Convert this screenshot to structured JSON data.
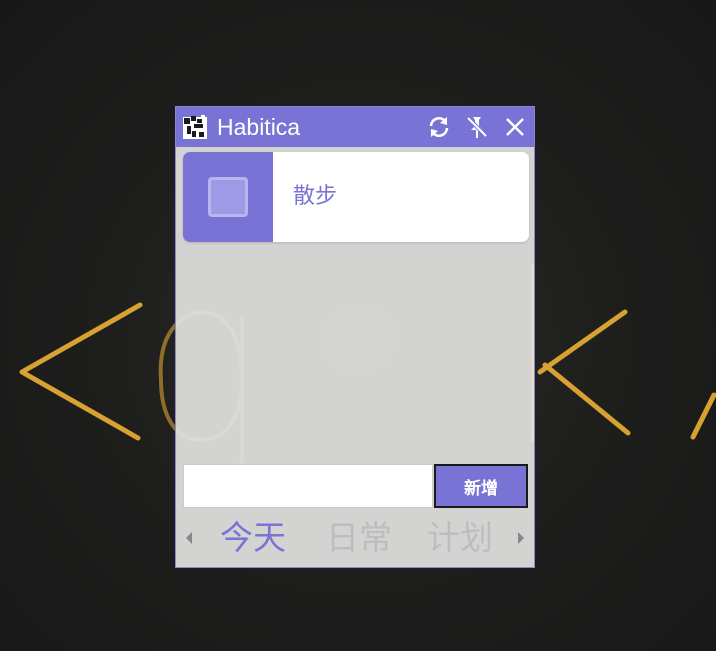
{
  "window": {
    "title": "Habitica",
    "accent_color": "#7a73d6",
    "titlebar_buttons": [
      {
        "name": "sync-icon"
      },
      {
        "name": "unpin-icon"
      },
      {
        "name": "close-icon"
      }
    ]
  },
  "tasks": [
    {
      "label": "散步",
      "checked": false
    }
  ],
  "add_task": {
    "input_value": "",
    "button_label": "新增"
  },
  "tabs": [
    {
      "label": "今天",
      "active": true
    },
    {
      "label": "日常",
      "active": false
    },
    {
      "label": "计划",
      "active": false
    }
  ],
  "desktop": {
    "wallpaper_text": "<geek/"
  }
}
